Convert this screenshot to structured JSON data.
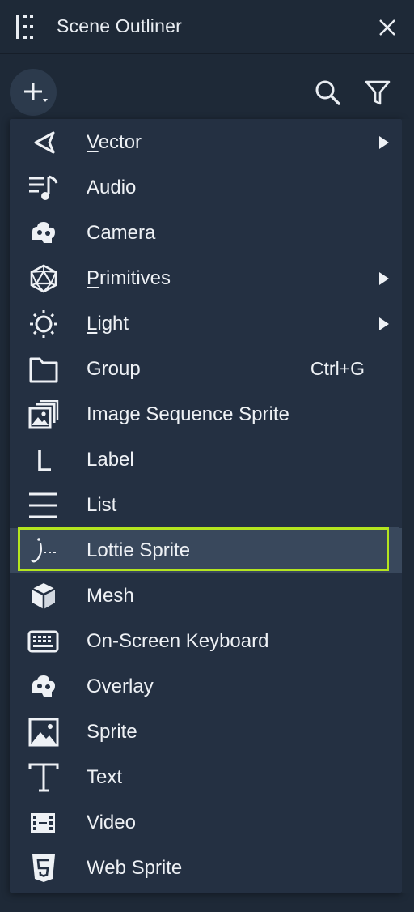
{
  "panel": {
    "title": "Scene Outliner",
    "icons": {
      "panel": "outliner-panel-icon",
      "close": "close-icon"
    }
  },
  "toolbar": {
    "add_button": "add-node-icon",
    "search": "search-icon",
    "filter": "filter-icon"
  },
  "menu": {
    "items": [
      {
        "pre": "",
        "mn": "V",
        "post": "ector",
        "icon": "vector-icon",
        "submenu": true,
        "shortcut": ""
      },
      {
        "pre": "Audio",
        "mn": "",
        "post": "",
        "icon": "audio-icon",
        "submenu": false,
        "shortcut": ""
      },
      {
        "pre": "Camera",
        "mn": "",
        "post": "",
        "icon": "camera-icon",
        "submenu": false,
        "shortcut": ""
      },
      {
        "pre": "",
        "mn": "P",
        "post": "rimitives",
        "icon": "primitives-icon",
        "submenu": true,
        "shortcut": ""
      },
      {
        "pre": "",
        "mn": "L",
        "post": "ight",
        "icon": "light-icon",
        "submenu": true,
        "shortcut": ""
      },
      {
        "pre": "Group",
        "mn": "",
        "post": "",
        "icon": "folder-icon",
        "submenu": false,
        "shortcut": "Ctrl+G"
      },
      {
        "pre": "Image Sequence Sprite",
        "mn": "",
        "post": "",
        "icon": "image-sequence-icon",
        "submenu": false,
        "shortcut": ""
      },
      {
        "pre": "Label",
        "mn": "",
        "post": "",
        "icon": "label-icon",
        "submenu": false,
        "shortcut": ""
      },
      {
        "pre": "List",
        "mn": "",
        "post": "",
        "icon": "list-icon",
        "submenu": false,
        "shortcut": ""
      },
      {
        "pre": "Lottie Sprite",
        "mn": "",
        "post": "",
        "icon": "lottie-icon",
        "submenu": false,
        "shortcut": ""
      },
      {
        "pre": "Mesh",
        "mn": "",
        "post": "",
        "icon": "mesh-icon",
        "submenu": false,
        "shortcut": ""
      },
      {
        "pre": "On-Screen Keyboard",
        "mn": "",
        "post": "",
        "icon": "keyboard-icon",
        "submenu": false,
        "shortcut": ""
      },
      {
        "pre": "Overlay",
        "mn": "",
        "post": "",
        "icon": "overlay-icon",
        "submenu": false,
        "shortcut": ""
      },
      {
        "pre": "Sprite",
        "mn": "",
        "post": "",
        "icon": "sprite-icon",
        "submenu": false,
        "shortcut": ""
      },
      {
        "pre": "Text",
        "mn": "",
        "post": "",
        "icon": "text-icon",
        "submenu": false,
        "shortcut": ""
      },
      {
        "pre": "Video",
        "mn": "",
        "post": "",
        "icon": "video-icon",
        "submenu": false,
        "shortcut": ""
      },
      {
        "pre": "Web Sprite",
        "mn": "",
        "post": "",
        "icon": "html5-icon",
        "submenu": false,
        "shortcut": ""
      }
    ],
    "selected_index": 9
  },
  "colors": {
    "background": "#1e2937",
    "menu_background": "#243042",
    "selected_row": "#39485c",
    "highlight_border": "#b4e51f",
    "text": "#eef1f5"
  }
}
